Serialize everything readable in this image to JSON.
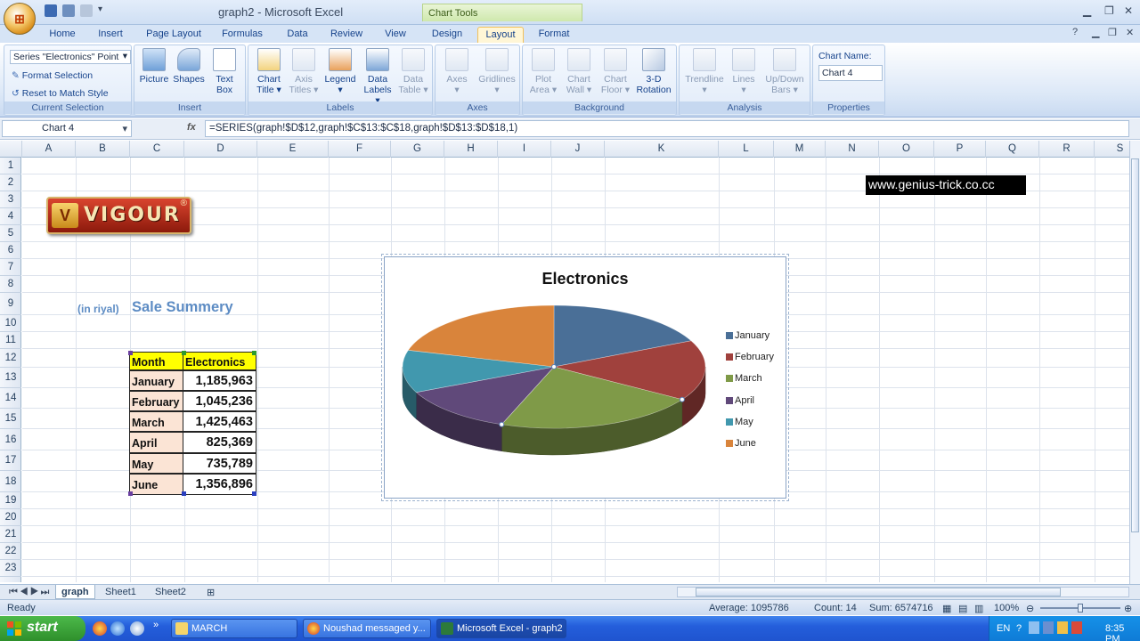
{
  "window": {
    "title": "graph2 - Microsoft Excel",
    "context_tab_group": "Chart Tools"
  },
  "tabs": [
    "Home",
    "Insert",
    "Page Layout",
    "Formulas",
    "Data",
    "Review",
    "View",
    "Design",
    "Layout",
    "Format"
  ],
  "active_tab": "Layout",
  "ribbon": {
    "current_selection": {
      "series_select": "Series \"Electronics\" Point",
      "format_selection": "Format Selection",
      "reset_to_match_style": "Reset to Match Style",
      "group_label": "Current Selection"
    },
    "insert": {
      "picture": "Picture",
      "shapes": "Shapes",
      "text_box_1": "Text",
      "text_box_2": "Box",
      "group_label": "Insert"
    },
    "labels": {
      "chart_title_1": "Chart",
      "chart_title_2": "Title",
      "axis_titles_1": "Axis",
      "axis_titles_2": "Titles",
      "legend": "Legend",
      "data_labels_1": "Data",
      "data_labels_2": "Labels",
      "data_table_1": "Data",
      "data_table_2": "Table",
      "group_label": "Labels"
    },
    "axes": {
      "axes": "Axes",
      "gridlines": "Gridlines",
      "group_label": "Axes"
    },
    "background": {
      "plot_area_1": "Plot",
      "plot_area_2": "Area",
      "chart_wall_1": "Chart",
      "chart_wall_2": "Wall",
      "chart_floor_1": "Chart",
      "chart_floor_2": "Floor",
      "rotation_1": "3-D",
      "rotation_2": "Rotation",
      "group_label": "Background"
    },
    "analysis": {
      "trendline": "Trendline",
      "lines": "Lines",
      "updown_1": "Up/Down",
      "updown_2": "Bars",
      "group_label": "Analysis"
    },
    "properties": {
      "chart_name_label": "Chart Name:",
      "chart_name_value": "Chart 4",
      "group_label": "Properties"
    }
  },
  "formula_bar": {
    "name_box": "Chart 4",
    "fx": "fx",
    "formula": "=SERIES(graph!$D$12,graph!$C$13:$C$18,graph!$D$13:$D$18,1)"
  },
  "columns": [
    "A",
    "B",
    "C",
    "D",
    "E",
    "F",
    "G",
    "H",
    "I",
    "J",
    "K",
    "L",
    "M",
    "N",
    "O",
    "P",
    "Q",
    "R",
    "S"
  ],
  "rows": [
    "1",
    "2",
    "3",
    "4",
    "5",
    "6",
    "7",
    "8",
    "9",
    "10",
    "11",
    "12",
    "13",
    "14",
    "15",
    "16",
    "17",
    "18",
    "19",
    "20",
    "21",
    "22",
    "23"
  ],
  "logo": {
    "text": "VIGOUR",
    "mark": "V",
    "reg": "®"
  },
  "url_text": "www.genius-trick.co.cc",
  "in_riyal": "(in riyal)",
  "sale_summery": "Sale Summery",
  "table": {
    "header": [
      "Month",
      "Electronics"
    ],
    "rows": [
      [
        "January",
        "1,185,963"
      ],
      [
        "February",
        "1,045,236"
      ],
      [
        "March",
        "1,425,463"
      ],
      [
        "April",
        "825,369"
      ],
      [
        "May",
        "735,789"
      ],
      [
        "June",
        "1,356,896"
      ]
    ]
  },
  "chart_data": {
    "type": "pie",
    "title": "Electronics",
    "categories": [
      "January",
      "February",
      "March",
      "April",
      "May",
      "June"
    ],
    "values": [
      1185963,
      1045236,
      1425463,
      825369,
      735789,
      1356896
    ],
    "colors": [
      "#4a6f97",
      "#a0413d",
      "#7f9a48",
      "#60497a",
      "#4198ae",
      "#d9843b"
    ],
    "legend": "right",
    "style": "3-D"
  },
  "sheets": [
    "graph",
    "Sheet1",
    "Sheet2"
  ],
  "active_sheet": "graph",
  "status": {
    "ready": "Ready",
    "average": "Average: 1095786",
    "count": "Count: 14",
    "sum": "Sum: 6574716",
    "zoom": "100%",
    "zoom_fraction": 0.5
  },
  "taskbar": {
    "start": "start",
    "tasks": [
      "MARCH",
      "Noushad messaged y...",
      "Microsoft Excel - graph2"
    ],
    "lang": "EN",
    "clock": "8:35 PM"
  }
}
